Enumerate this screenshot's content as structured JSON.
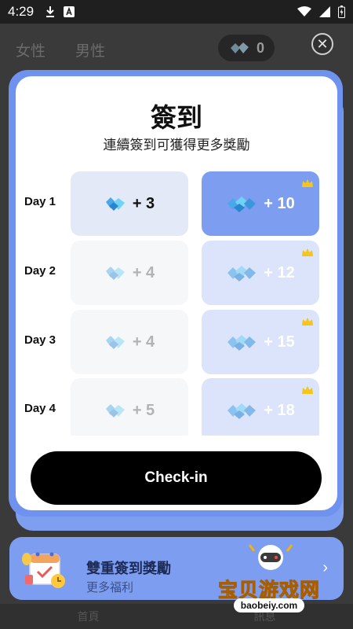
{
  "status_bar": {
    "time": "4:29"
  },
  "background": {
    "tabs": [
      "女性",
      "男性"
    ],
    "coin_count": "0",
    "bottom_nav": [
      "首頁",
      "訊息"
    ]
  },
  "modal": {
    "title": "簽到",
    "subtitle": "連續簽到可獲得更多獎勵",
    "rows": [
      {
        "day": "Day 1",
        "basic": "+ 3",
        "vip": "+ 10"
      },
      {
        "day": "Day 2",
        "basic": "+ 4",
        "vip": "+ 12"
      },
      {
        "day": "Day 3",
        "basic": "+ 4",
        "vip": "+ 15"
      },
      {
        "day": "Day 4",
        "basic": "+ 5",
        "vip": "+ 18"
      }
    ],
    "checkin_label": "Check-in"
  },
  "banner": {
    "title": "雙重簽到獎勵",
    "subtitle": "更多福利",
    "arrow": "›"
  },
  "watermark": {
    "text": "宝贝游戏网",
    "url": "baobeiy.com"
  },
  "colors": {
    "accent": "#7d9df0",
    "accent_light": "#dbe4fb",
    "button": "#000000",
    "crown": "#f5c518"
  },
  "icons": [
    "download-icon",
    "a-icon",
    "wifi-icon",
    "signal-icon",
    "battery-icon",
    "close-icon",
    "gem-icon",
    "gem-pile-icon",
    "crown-icon",
    "calendar-gift-icon",
    "chevron-right-icon"
  ]
}
